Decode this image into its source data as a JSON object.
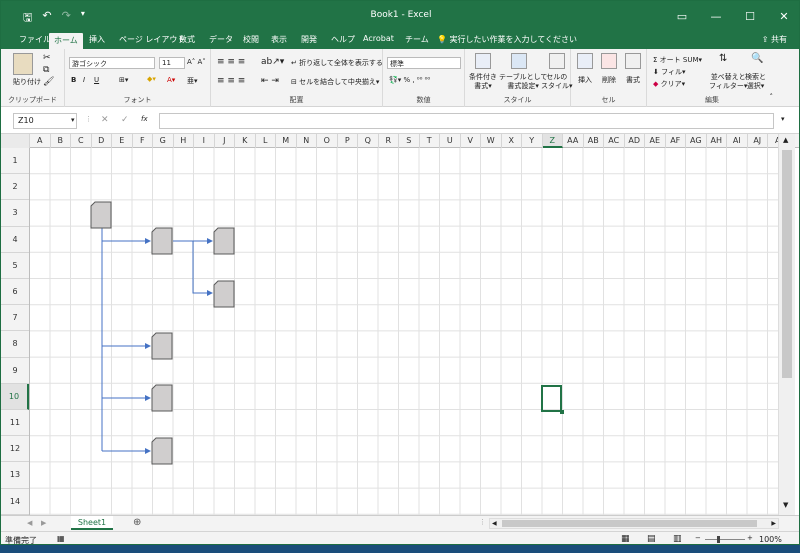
{
  "window": {
    "title": "Book1  -  Excel"
  },
  "ribbon_tabs": [
    "ファイル",
    "ホーム",
    "挿入",
    "ページ レイアウト",
    "数式",
    "データ",
    "校閲",
    "表示",
    "開発",
    "ヘルプ",
    "Acrobat",
    "チーム"
  ],
  "tell_me": "実行したい作業を入力してください",
  "share": "共有",
  "ribbon": {
    "paste": "貼り付け",
    "clipboard": "クリップボード",
    "font_name": "游ゴシック",
    "font_size": "11",
    "font": "フォント",
    "wrap": "折り返して全体を表示する",
    "merge": "セルを結合して中央揃え",
    "alignment": "配置",
    "number_format": "標準",
    "number": "数値",
    "cond_format_1": "条件付き",
    "cond_format_2": "書式",
    "table_format_1": "テーブルとして",
    "table_format_2": "書式設定",
    "cell_style_1": "セルの",
    "cell_style_2": "スタイル",
    "styles": "スタイル",
    "insert": "挿入",
    "delete": "削除",
    "format": "書式",
    "cells": "セル",
    "autosum": "オート SUM",
    "fill": "フィル",
    "clear": "クリア",
    "sort_1": "並べ替えと",
    "sort_2": "フィルター",
    "find_1": "検索と",
    "find_2": "選択",
    "editing": "編集"
  },
  "name_box": "Z10",
  "fx": "fx",
  "columns": [
    "A",
    "B",
    "C",
    "D",
    "E",
    "F",
    "G",
    "H",
    "I",
    "J",
    "K",
    "L",
    "M",
    "N",
    "O",
    "P",
    "Q",
    "R",
    "S",
    "T",
    "U",
    "V",
    "W",
    "X",
    "Y",
    "Z",
    "AA",
    "AB",
    "AC",
    "AD",
    "AE",
    "AF",
    "AG",
    "AH",
    "AI",
    "AJ",
    "A"
  ],
  "selected_column": "Z",
  "rows": [
    "1",
    "2",
    "3",
    "4",
    "5",
    "6",
    "7",
    "8",
    "9",
    "10",
    "11",
    "12",
    "13",
    "14"
  ],
  "selected_row": "10",
  "sheet_tab": "Sheet1",
  "status": "準備完了",
  "zoom": "100%",
  "colors": {
    "accent": "#217346",
    "connector": "#4472c4",
    "shape_fill": "#d0cece",
    "shape_border": "#595959"
  }
}
